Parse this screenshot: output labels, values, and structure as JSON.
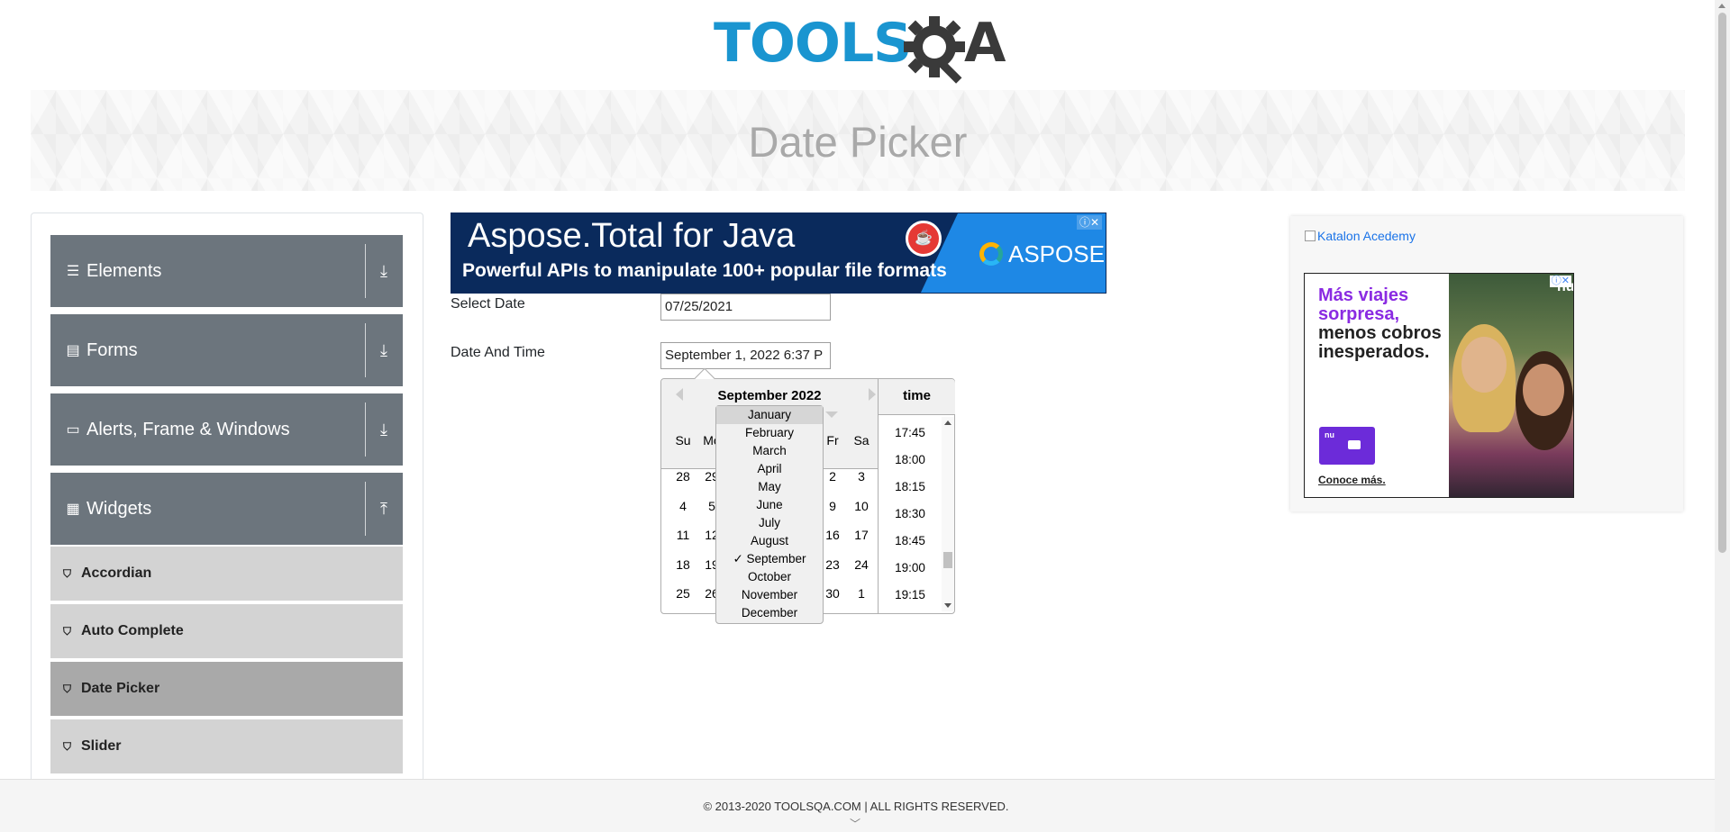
{
  "logo": {
    "text": "TOOLS",
    "suffix": "A"
  },
  "banner": {
    "title": "Date Picker"
  },
  "sidebar": {
    "groups": [
      {
        "label": "Elements"
      },
      {
        "label": "Forms"
      },
      {
        "label": "Alerts, Frame & Windows"
      },
      {
        "label": "Widgets"
      }
    ],
    "items": [
      {
        "label": "Accordian"
      },
      {
        "label": "Auto Complete"
      },
      {
        "label": "Date Picker"
      },
      {
        "label": "Slider"
      }
    ]
  },
  "ad_top": {
    "title": "Aspose.Total for Java",
    "tagline": "Powerful APIs to manipulate 100+ popular file formats",
    "brand": "ASPOSE"
  },
  "form": {
    "select_date_label": "Select Date",
    "select_date_value": "07/25/2021",
    "date_time_label": "Date And Time",
    "date_time_value": "September 1, 2022 6:37 P"
  },
  "datepicker": {
    "month_label": "September 2022",
    "year_partial": "2",
    "day_names": [
      "Su",
      "Mo",
      "",
      "",
      "",
      "Fr",
      "Sa"
    ],
    "weeks": [
      [
        "28",
        "29",
        "",
        "",
        "",
        "2",
        "3"
      ],
      [
        "4",
        "5",
        "",
        "",
        "",
        "9",
        "10"
      ],
      [
        "11",
        "12",
        "",
        "",
        "",
        "16",
        "17"
      ],
      [
        "18",
        "19",
        "",
        "",
        "",
        "23",
        "24"
      ],
      [
        "25",
        "26",
        "",
        "",
        "",
        "30",
        "1"
      ]
    ],
    "time_header": "time",
    "times": [
      "17:45",
      "18:00",
      "18:15",
      "18:30",
      "18:45",
      "19:00",
      "19:15"
    ],
    "month_options": [
      "January",
      "February",
      "March",
      "April",
      "May",
      "June",
      "July",
      "August",
      "✓ September",
      "October",
      "November",
      "December"
    ]
  },
  "ad_right": {
    "link_text": "Katalon Acedemy",
    "headline_purple": "Más viajes sorpresa,",
    "headline_dark": "menos cobros inesperados.",
    "cta": "Conoce más.",
    "brand": "nu"
  },
  "footer": {
    "text": "© 2013-2020 TOOLSQA.COM | ALL RIGHTS RESERVED."
  }
}
